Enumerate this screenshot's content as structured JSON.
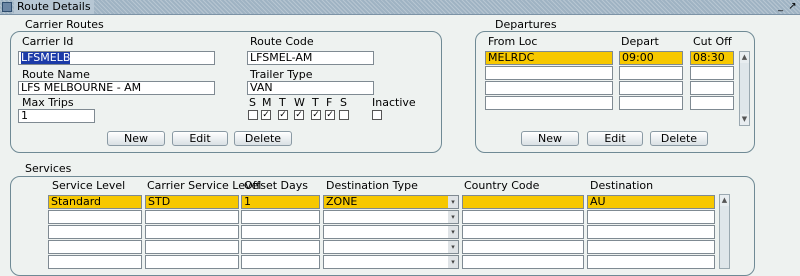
{
  "window": {
    "title": "Route Details",
    "min_icon": "minimize-icon",
    "max_icon": "maximize-icon"
  },
  "carrier_routes": {
    "group_label": "Carrier Routes",
    "carrier_id_label": "Carrier Id",
    "carrier_id_value": "LFSMELB",
    "route_code_label": "Route Code",
    "route_code_value": "LFSMEL-AM",
    "route_name_label": "Route Name",
    "route_name_value": "LFS MELBOURNE - AM",
    "trailer_type_label": "Trailer Type",
    "trailer_type_value": "VAN",
    "max_trips_label": "Max Trips",
    "max_trips_value": "1",
    "days": [
      {
        "label": "S",
        "checked": false
      },
      {
        "label": "M",
        "checked": true
      },
      {
        "label": "T",
        "checked": true
      },
      {
        "label": "W",
        "checked": true
      },
      {
        "label": "T",
        "checked": true
      },
      {
        "label": "F",
        "checked": true
      },
      {
        "label": "S",
        "checked": false
      }
    ],
    "inactive_label": "Inactive",
    "inactive_checked": false,
    "buttons": {
      "new": "New",
      "edit": "Edit",
      "delete": "Delete"
    }
  },
  "departures": {
    "group_label": "Departures",
    "headers": {
      "from_loc": "From Loc",
      "depart": "Depart",
      "cut_off": "Cut Off"
    },
    "rows": [
      {
        "from_loc": "MELRDC",
        "depart": "09:00",
        "cut_off": "08:30"
      },
      {
        "from_loc": "",
        "depart": "",
        "cut_off": ""
      },
      {
        "from_loc": "",
        "depart": "",
        "cut_off": ""
      },
      {
        "from_loc": "",
        "depart": "",
        "cut_off": ""
      }
    ],
    "buttons": {
      "new": "New",
      "edit": "Edit",
      "delete": "Delete"
    }
  },
  "services": {
    "group_label": "Services",
    "headers": {
      "service_level": "Service Level",
      "carrier_service_level": "Carrier Service Level",
      "offset_days": "Offset Days",
      "destination_type": "Destination Type",
      "country_code": "Country Code",
      "destination": "Destination"
    },
    "rows": [
      {
        "service_level": "Standard",
        "carrier_service_level": "STD",
        "offset_days": "1",
        "destination_type": "ZONE",
        "country_code": "",
        "destination": "AU"
      },
      {
        "service_level": "",
        "carrier_service_level": "",
        "offset_days": "",
        "destination_type": "",
        "country_code": "",
        "destination": ""
      },
      {
        "service_level": "",
        "carrier_service_level": "",
        "offset_days": "",
        "destination_type": "",
        "country_code": "",
        "destination": ""
      },
      {
        "service_level": "",
        "carrier_service_level": "",
        "offset_days": "",
        "destination_type": "",
        "country_code": "",
        "destination": ""
      },
      {
        "service_level": "",
        "carrier_service_level": "",
        "offset_days": "",
        "destination_type": "",
        "country_code": "",
        "destination": ""
      }
    ]
  },
  "colors": {
    "selected_row": "#f7c800",
    "selection_highlight": "#1b3aa8",
    "border": "#6f8a95"
  }
}
